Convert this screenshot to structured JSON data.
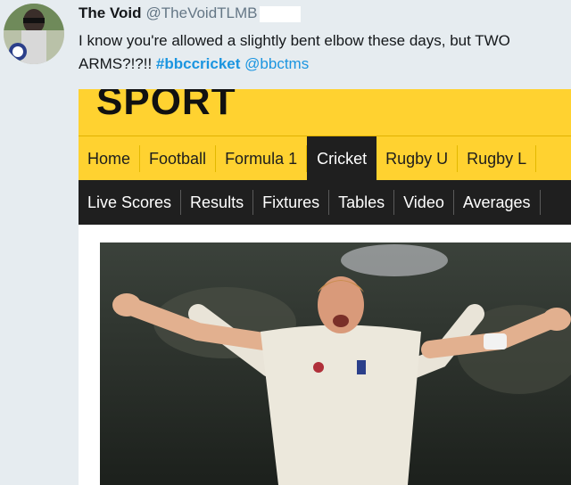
{
  "tweet": {
    "display_name": "The Void",
    "handle": "@TheVoidTLMB",
    "text_line1": "I know you're allowed a slightly bent elbow these days, but TWO",
    "text_line2_prefix": "ARMS?!?!! ",
    "hashtag": "#bbccricket",
    "mention": "@bbctms"
  },
  "card": {
    "logo": "SPORT",
    "primary_nav": [
      "Home",
      "Football",
      "Formula 1",
      "Cricket",
      "Rugby U",
      "Rugby L"
    ],
    "active_primary": "Cricket",
    "secondary_nav": [
      "Live Scores",
      "Results",
      "Fixtures",
      "Tables",
      "Video",
      "Averages"
    ]
  },
  "colors": {
    "bbc_yellow": "#ffd230",
    "nav_dark": "#1f1f1f",
    "link_blue": "#1b95e0"
  }
}
